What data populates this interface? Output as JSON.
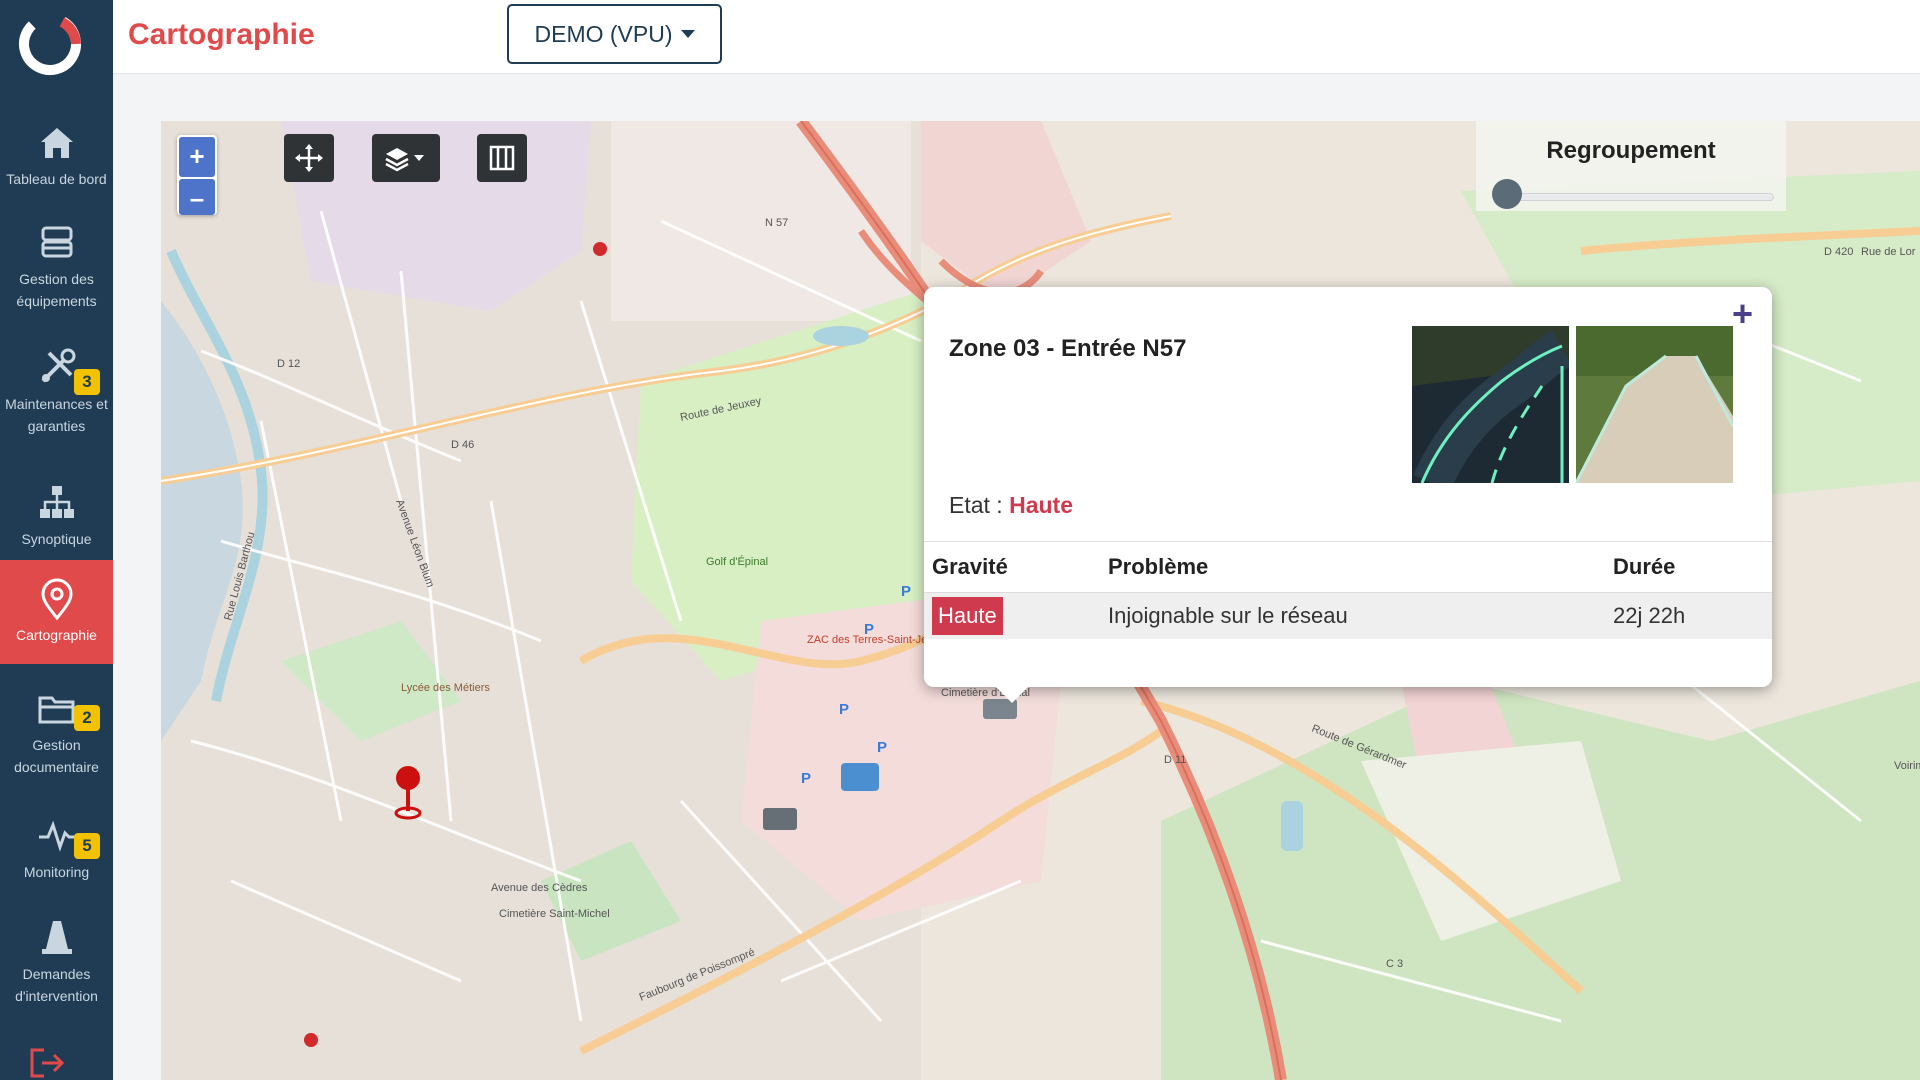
{
  "app": {
    "page_title": "Cartographie",
    "site_selector": "DEMO (VPU)"
  },
  "sidebar": {
    "items": [
      {
        "label": "Tableau de bord",
        "icon": "home-icon"
      },
      {
        "label": "Gestion des équipements",
        "icon": "inbox-stack-icon"
      },
      {
        "label": "Maintenances et garanties",
        "icon": "tools-icon",
        "badge": "3"
      },
      {
        "label": "Synoptique",
        "icon": "sitemap-icon"
      },
      {
        "label": "Cartographie",
        "icon": "map-pin-icon",
        "active": true
      },
      {
        "label": "Gestion documentaire",
        "icon": "folder-icon",
        "badge": "2"
      },
      {
        "label": "Monitoring",
        "icon": "pulse-icon",
        "badge": "5"
      },
      {
        "label": "Demandes d'intervention",
        "icon": "cone-icon"
      }
    ],
    "logout_icon": "logout-icon"
  },
  "map": {
    "zoom_in": "+",
    "zoom_out": "–",
    "cluster_label": "Regroupement",
    "cluster_value": 0,
    "labels": [
      "N 57",
      "D 46",
      "D 12",
      "D 11",
      "C 3",
      "D 420",
      "Route de Jeuxey",
      "Golf d'Épinal",
      "ZAC des Terres-Saint-Jean",
      "Rue de Lor",
      "Voirimenil",
      "Cimetière d'Épinal",
      "Route de Gérardmer",
      "Faubourg de Poissompré",
      "Avenue Léon Blum",
      "Avenue des Cèdres",
      "Rue Louis Barthou",
      "Lycée des Métiers",
      "Cimetière Saint-Michel"
    ]
  },
  "popup": {
    "title": "Zone 03 - Entrée N57",
    "etat_label": "Etat :",
    "etat_value": "Haute",
    "expand": "+",
    "table": {
      "headers": [
        "Gravité",
        "Problème",
        "Durée"
      ],
      "rows": [
        {
          "gravite": "Haute",
          "probleme": "Injoignable sur le réseau",
          "duree": "22j 22h"
        }
      ]
    }
  },
  "colors": {
    "sidebar_bg": "#1f3c54",
    "accent_red": "#e04a4a",
    "badge_yellow": "#f2c200",
    "severity_high": "#d03a4e"
  }
}
